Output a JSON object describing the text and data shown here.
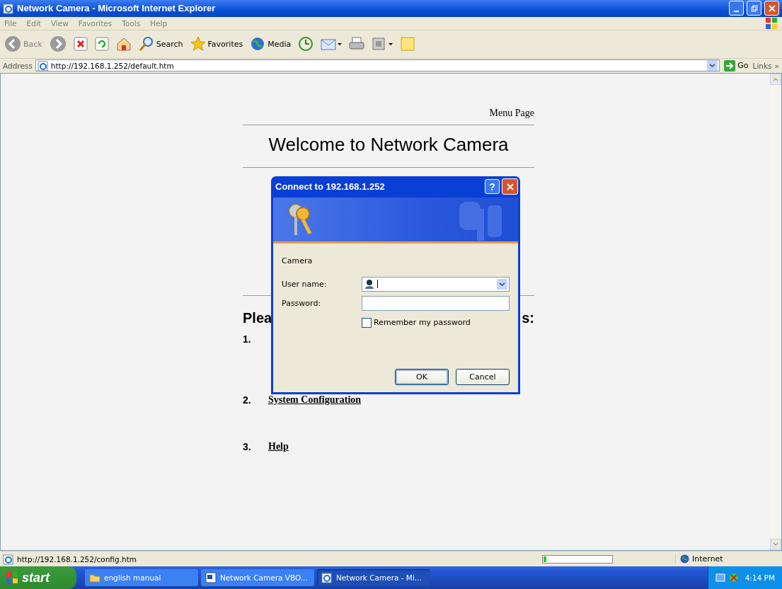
{
  "window": {
    "title": "Network Camera - Microsoft Internet Explorer"
  },
  "menu": [
    "File",
    "Edit",
    "View",
    "Favorites",
    "Tools",
    "Help"
  ],
  "toolbar": [
    {
      "kind": "back",
      "label": "Back"
    },
    {
      "kind": "forward"
    },
    {
      "kind": "stop"
    },
    {
      "kind": "refresh"
    },
    {
      "kind": "home"
    },
    {
      "kind": "search",
      "label": "Search"
    },
    {
      "kind": "favorites",
      "label": "Favorites"
    },
    {
      "kind": "media",
      "label": "Media"
    },
    {
      "kind": "history"
    },
    {
      "kind": "mail"
    },
    {
      "kind": "print"
    },
    {
      "kind": "edit"
    },
    {
      "kind": "notes"
    }
  ],
  "address_bar": {
    "label": "Address",
    "url": "http://192.168.1.252/default.htm",
    "go": "Go",
    "links": "Links",
    "more": "»"
  },
  "page": {
    "menu_link": "Menu Page",
    "title": "Welcome to Network Camera",
    "heading_fragments": [
      "Plea",
      "s:"
    ],
    "items": [
      {
        "number": "1."
      },
      {
        "number": "2.",
        "lines": [
          "System Configuration"
        ]
      },
      {
        "number": "3.",
        "lines": [
          "Help"
        ]
      }
    ]
  },
  "dialog": {
    "title": "Connect to 192.168.1.252",
    "help": "?",
    "realm": "Camera",
    "fields": [
      {
        "kind": "combo",
        "label": "User name:"
      },
      {
        "kind": "password",
        "label": "Password:"
      }
    ],
    "remember": {
      "label": "Remember my password",
      "checked": false
    },
    "buttons": [
      {
        "label": "OK",
        "default": true
      },
      {
        "label": "Cancel",
        "default": false
      }
    ]
  },
  "status_bar": {
    "url": "http://192.168.1.252/config.htm",
    "progress": {
      "level": 0.04
    },
    "zone": "Internet"
  },
  "taskbar": {
    "start": "start",
    "tasks": [
      {
        "label": "english manual",
        "kind": "folder",
        "selected": false
      },
      {
        "label": "Network Camera VBO...",
        "kind": "word",
        "selected": false
      },
      {
        "label": "Network Camera - Mi...",
        "kind": "ie",
        "selected": true
      }
    ],
    "clock": "4:14 PM"
  }
}
